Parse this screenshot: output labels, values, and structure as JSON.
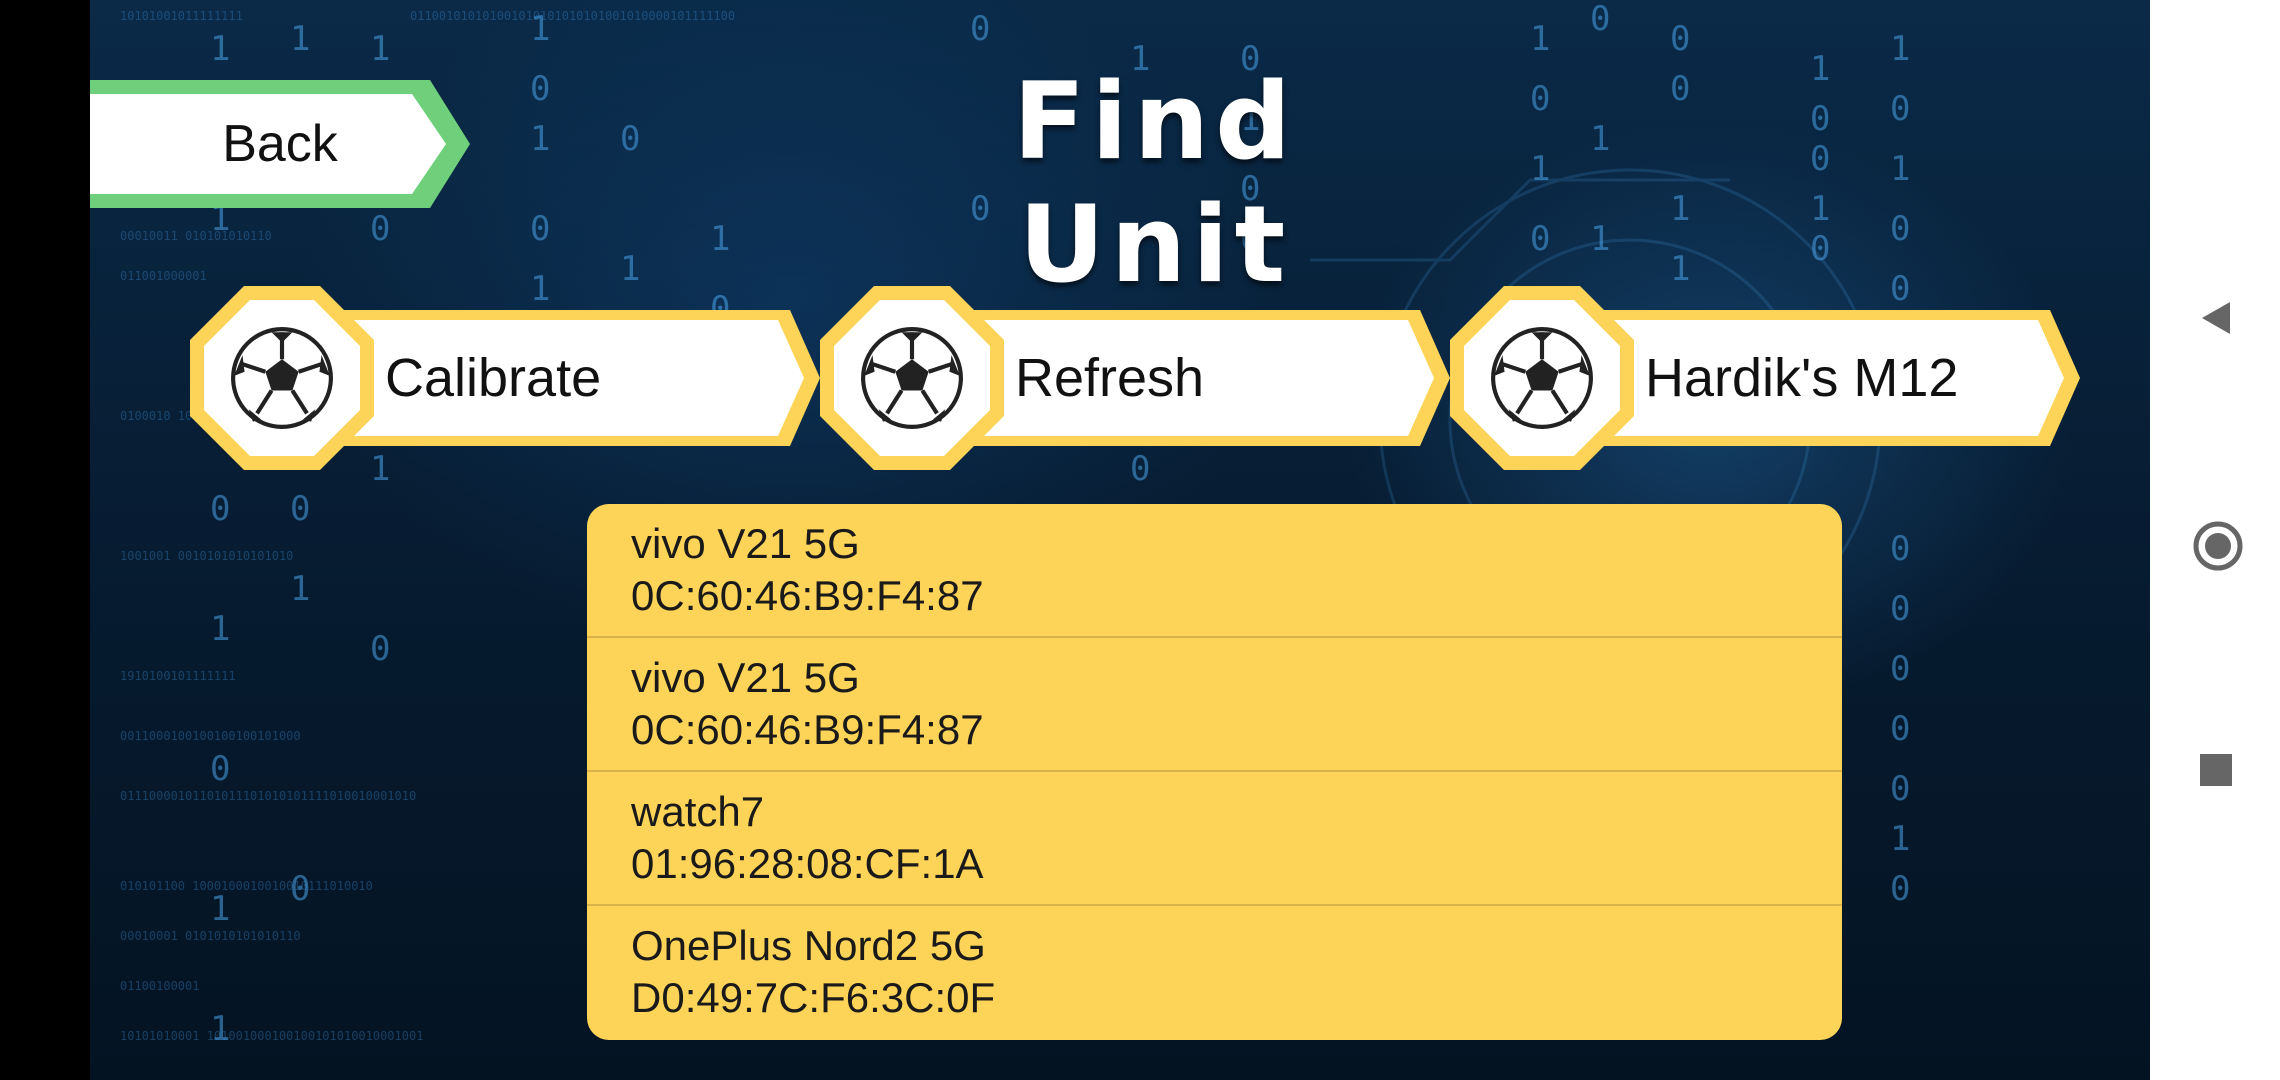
{
  "header": {
    "title": "Find Unit",
    "back_label": "Back"
  },
  "actions": [
    {
      "label": "Calibrate",
      "icon": "soccer-ball-icon"
    },
    {
      "label": "Refresh",
      "icon": "soccer-ball-icon"
    },
    {
      "label": "Hardik's M12",
      "icon": "soccer-ball-icon"
    }
  ],
  "devices": [
    {
      "name": "vivo V21 5G",
      "mac": "0C:60:46:B9:F4:87"
    },
    {
      "name": "vivo V21 5G",
      "mac": "0C:60:46:B9:F4:87"
    },
    {
      "name": "watch7",
      "mac": "01:96:28:08:CF:1A"
    },
    {
      "name": "OnePlus Nord2 5G",
      "mac": "D0:49:7C:F6:3C:0F"
    }
  ],
  "colors": {
    "accent_yellow": "#fdd457",
    "back_border_green": "#6fcf7a",
    "background": "#0a2a48"
  },
  "system_nav": {
    "back_icon": "triangle-back-icon",
    "home_icon": "circle-home-icon",
    "recents_icon": "square-recents-icon"
  }
}
